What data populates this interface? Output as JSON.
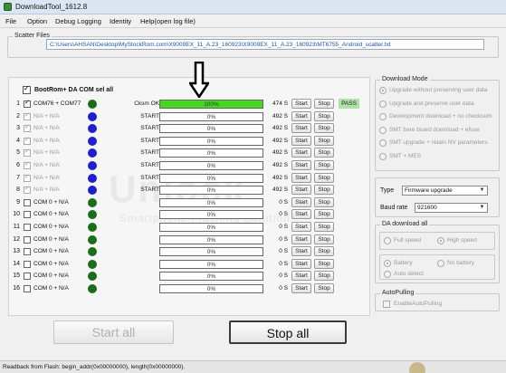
{
  "window": {
    "title": "DownloadTool_1612.8"
  },
  "menu": [
    "File",
    "Option",
    "Debug Logging",
    "Identity",
    "Help(open log file)"
  ],
  "scatter": {
    "legend": "Scatter Files",
    "path": "C:\\Users\\AHSAN\\Desktop\\MyStockRom.com\\X9009EX_11_A.23_160923\\X9009EX_11_A.23_160923\\MT6755_Android_scatter.txt"
  },
  "header_checkbox_label": "BootRom+ DA COM sel all",
  "ports": [
    {
      "num": "1",
      "com": "COM76 + COM77",
      "status": "Cksm OK",
      "progress_label": "100%",
      "progress": 1.0,
      "time": "474 S",
      "start": "Start",
      "stop": "Stop",
      "result": "PASS",
      "dot_color": "#1b6d1b",
      "checked": true,
      "grey": false
    },
    {
      "num": "2",
      "com": "N/A + N/A",
      "status": "START",
      "progress_label": "0%",
      "progress": 0,
      "time": "492 S",
      "start": "Start",
      "stop": "Stop",
      "result": "",
      "dot_color": "#1f1fd2",
      "checked": true,
      "grey": true
    },
    {
      "num": "3",
      "com": "N/A + N/A",
      "status": "START",
      "progress_label": "0%",
      "progress": 0,
      "time": "492 S",
      "start": "Start",
      "stop": "Stop",
      "result": "",
      "dot_color": "#1f1fd2",
      "checked": true,
      "grey": true
    },
    {
      "num": "4",
      "com": "N/A + N/A",
      "status": "START",
      "progress_label": "0%",
      "progress": 0,
      "time": "492 S",
      "start": "Start",
      "stop": "Stop",
      "result": "",
      "dot_color": "#1f1fd2",
      "checked": true,
      "grey": true
    },
    {
      "num": "5",
      "com": "N/A + N/A",
      "status": "START",
      "progress_label": "0%",
      "progress": 0,
      "time": "492 S",
      "start": "Start",
      "stop": "Stop",
      "result": "",
      "dot_color": "#1f1fd2",
      "checked": true,
      "grey": true
    },
    {
      "num": "6",
      "com": "N/A + N/A",
      "status": "START",
      "progress_label": "0%",
      "progress": 0,
      "time": "492 S",
      "start": "Start",
      "stop": "Stop",
      "result": "",
      "dot_color": "#1f1fd2",
      "checked": true,
      "grey": true
    },
    {
      "num": "7",
      "com": "N/A + N/A",
      "status": "START",
      "progress_label": "0%",
      "progress": 0,
      "time": "492 S",
      "start": "Start",
      "stop": "Stop",
      "result": "",
      "dot_color": "#1f1fd2",
      "checked": true,
      "grey": true
    },
    {
      "num": "8",
      "com": "N/A + N/A",
      "status": "START",
      "progress_label": "0%",
      "progress": 0,
      "time": "492 S",
      "start": "Start",
      "stop": "Stop",
      "result": "",
      "dot_color": "#1f1fd2",
      "checked": true,
      "grey": true
    },
    {
      "num": "9",
      "com": "COM 0 + N/A",
      "status": "",
      "progress_label": "0%",
      "progress": 0,
      "time": "0 S",
      "start": "Start",
      "stop": "Stop",
      "result": "",
      "dot_color": "#1b6d1b",
      "checked": false,
      "grey": false
    },
    {
      "num": "10",
      "com": "COM 0 + N/A",
      "status": "",
      "progress_label": "0%",
      "progress": 0,
      "time": "0 S",
      "start": "Start",
      "stop": "Stop",
      "result": "",
      "dot_color": "#1b6d1b",
      "checked": false,
      "grey": false
    },
    {
      "num": "11",
      "com": "COM 0 + N/A",
      "status": "",
      "progress_label": "0%",
      "progress": 0,
      "time": "0 S",
      "start": "Start",
      "stop": "Stop",
      "result": "",
      "dot_color": "#1b6d1b",
      "checked": false,
      "grey": false
    },
    {
      "num": "12",
      "com": "COM 0 + N/A",
      "status": "",
      "progress_label": "0%",
      "progress": 0,
      "time": "0 S",
      "start": "Start",
      "stop": "Stop",
      "result": "",
      "dot_color": "#1b6d1b",
      "checked": false,
      "grey": false
    },
    {
      "num": "13",
      "com": "COM 0 + N/A",
      "status": "",
      "progress_label": "0%",
      "progress": 0,
      "time": "0 S",
      "start": "Start",
      "stop": "Stop",
      "result": "",
      "dot_color": "#1b6d1b",
      "checked": false,
      "grey": false
    },
    {
      "num": "14",
      "com": "COM 0 + N/A",
      "status": "",
      "progress_label": "0%",
      "progress": 0,
      "time": "0 S",
      "start": "Start",
      "stop": "Stop",
      "result": "",
      "dot_color": "#1b6d1b",
      "checked": false,
      "grey": false
    },
    {
      "num": "15",
      "com": "COM 0 + N/A",
      "status": "",
      "progress_label": "0%",
      "progress": 0,
      "time": "0 S",
      "start": "Start",
      "stop": "Stop",
      "result": "",
      "dot_color": "#1b6d1b",
      "checked": false,
      "grey": false
    },
    {
      "num": "16",
      "com": "COM 0 + N/A",
      "status": "",
      "progress_label": "0%",
      "progress": 0,
      "time": "0 S",
      "start": "Start",
      "stop": "Stop",
      "result": "",
      "dot_color": "#1b6d1b",
      "checked": false,
      "grey": false
    }
  ],
  "download_mode": {
    "legend": "Download Mode",
    "options": [
      "Upgrade without preserving user data",
      "Upgrade and preserve user data",
      "Development download + no checksum",
      "SMT bare board download + efuse",
      "SMT upgrade + retain NV parameters",
      "SMT + MES"
    ],
    "selected_index": 0
  },
  "type_label": "Type",
  "type_value": "Firmware upgrade",
  "baud_label": "Baud rate",
  "baud_value": "921600",
  "da_download": {
    "legend": "DA download all",
    "speed_options": [
      "Full speed",
      "High speed"
    ],
    "speed_selected": 1,
    "power_options": [
      "Battery",
      "No battery",
      "Auto detect"
    ],
    "power_selected": 0
  },
  "auto_pulling": {
    "legend": "AutoPulling",
    "checkbox_label": "EnableAutoPulling"
  },
  "buttons": {
    "start_all": "Start all",
    "stop_all": "Stop all"
  },
  "status_bar": "Readback from Flash:  begin_addr(0x00000000), length(0x00000000).",
  "watermark": {
    "main": "Unlock",
    "sub": "Smartphone Flashing Solution"
  }
}
